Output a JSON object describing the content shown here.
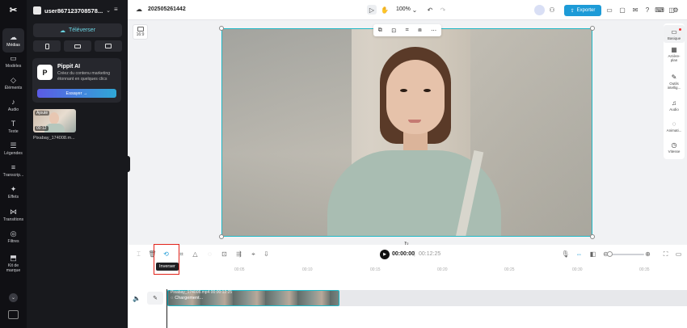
{
  "nav": {
    "logo": "✂",
    "items": [
      {
        "label": "Médias",
        "icon": "☁"
      },
      {
        "label": "Modèles",
        "icon": "▭"
      },
      {
        "label": "Éléments",
        "icon": "◇"
      },
      {
        "label": "Audio",
        "icon": "♪"
      },
      {
        "label": "Texte",
        "icon": "T"
      },
      {
        "label": "Légendes",
        "icon": "☰"
      },
      {
        "label": "Transcrip...",
        "icon": "≡"
      },
      {
        "label": "Effets",
        "icon": "✦"
      },
      {
        "label": "Transitions",
        "icon": "⋈"
      },
      {
        "label": "Filtres",
        "icon": "◎"
      },
      {
        "label": "Kit de marque",
        "icon": "⬒"
      }
    ]
  },
  "panel": {
    "username": "user867123708578...",
    "upload_label": "Téléverser",
    "promo": {
      "title": "Pippit AI",
      "description": "Créez du contenu marketing étonnant en quelques clics",
      "button": "Essayer →"
    },
    "media": {
      "badge": "Ajouté",
      "duration": "00:12",
      "name": "Pixabay_174008.m..."
    }
  },
  "topbar": {
    "project_name": "202505261442",
    "zoom": "100%",
    "export_label": "Exporter"
  },
  "canvas": {
    "ratio_label": "16:9"
  },
  "right_sidebar": [
    {
      "label": "Basique",
      "icon": "▭"
    },
    {
      "label": "Arrière-plan",
      "icon": "▦"
    },
    {
      "label": "Outils intellig...",
      "icon": "✎"
    },
    {
      "label": "Audio",
      "icon": "♫"
    },
    {
      "label": "Animati...",
      "icon": "◌"
    },
    {
      "label": "Vitesse",
      "icon": "◷"
    }
  ],
  "timeline": {
    "tooltip": "Inverser",
    "current_time": "00:00:00",
    "separator": "|",
    "total_time": "00:12:25",
    "ruler": [
      "00:05",
      "00:10",
      "00:15",
      "00:20",
      "00:25",
      "00:30",
      "00:35"
    ],
    "clip_label": "Pixabay_174008.mp4  00:00:12:25",
    "clip_status": "Chargement..."
  },
  "colors": {
    "accent": "#1d9bd7",
    "selection": "#20b8c6",
    "highlight": "#e2231a"
  }
}
